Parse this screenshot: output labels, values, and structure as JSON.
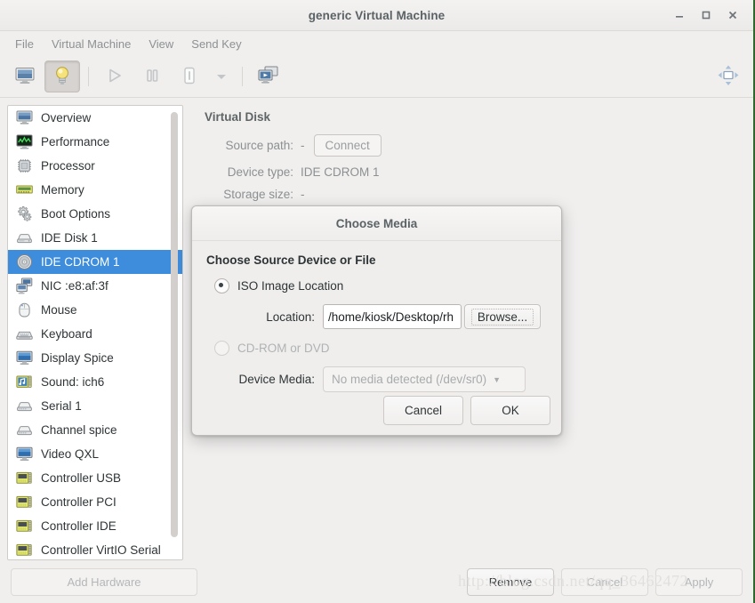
{
  "window": {
    "title": "generic Virtual Machine",
    "controls": [
      {
        "name": "minimize",
        "glyph": "–"
      },
      {
        "name": "maximize",
        "glyph": "□"
      },
      {
        "name": "close",
        "glyph": "✕"
      }
    ]
  },
  "menubar": {
    "items": [
      "File",
      "Virtual Machine",
      "View",
      "Send Key"
    ]
  },
  "toolbar": {
    "buttons": [
      {
        "name": "show-console-view",
        "icon": "monitor-icon",
        "pressed": false
      },
      {
        "name": "show-details-view",
        "icon": "lightbulb-icon",
        "pressed": true
      },
      {
        "name": "run-vm",
        "icon": "play-icon",
        "pressed": false
      },
      {
        "name": "pause-vm",
        "icon": "pause-icon",
        "pressed": false
      },
      {
        "name": "shutdown-vm",
        "icon": "power-icon",
        "pressed": false
      },
      {
        "name": "shutdown-menu",
        "icon": "chevron-down-icon",
        "pressed": false
      },
      {
        "name": "manage-snapshots",
        "icon": "snapshots-icon",
        "pressed": false
      }
    ],
    "fullscreen": {
      "name": "fullscreen-button",
      "icon": "expand-icon"
    }
  },
  "sidebar": {
    "items": [
      {
        "label": "Overview",
        "icon": "monitor-icon",
        "selected": false
      },
      {
        "label": "Performance",
        "icon": "graph-icon",
        "selected": false
      },
      {
        "label": "Processor",
        "icon": "cpu-icon",
        "selected": false
      },
      {
        "label": "Memory",
        "icon": "memory-icon",
        "selected": false
      },
      {
        "label": "Boot Options",
        "icon": "gears-icon",
        "selected": false
      },
      {
        "label": "IDE Disk 1",
        "icon": "harddisk-icon",
        "selected": false
      },
      {
        "label": "IDE CDROM 1",
        "icon": "cdrom-icon",
        "selected": true
      },
      {
        "label": "NIC :e8:af:3f",
        "icon": "network-icon",
        "selected": false
      },
      {
        "label": "Mouse",
        "icon": "mouse-icon",
        "selected": false
      },
      {
        "label": "Keyboard",
        "icon": "keyboard-icon",
        "selected": false
      },
      {
        "label": "Display Spice",
        "icon": "display-icon",
        "selected": false
      },
      {
        "label": "Sound: ich6",
        "icon": "sound-icon",
        "selected": false
      },
      {
        "label": "Serial 1",
        "icon": "serial-icon",
        "selected": false
      },
      {
        "label": "Channel spice",
        "icon": "serial-icon",
        "selected": false
      },
      {
        "label": "Video QXL",
        "icon": "display-icon",
        "selected": false
      },
      {
        "label": "Controller USB",
        "icon": "controller-icon",
        "selected": false
      },
      {
        "label": "Controller PCI",
        "icon": "controller-icon",
        "selected": false
      },
      {
        "label": "Controller IDE",
        "icon": "controller-icon",
        "selected": false
      },
      {
        "label": "Controller VirtIO Serial",
        "icon": "controller-icon",
        "selected": false
      }
    ]
  },
  "detail": {
    "heading": "Virtual Disk",
    "rows": [
      {
        "label": "Source path:",
        "value": "-",
        "button": "Connect"
      },
      {
        "label": "Device type:",
        "value": "IDE CDROM 1",
        "button": null
      },
      {
        "label": "Storage size:",
        "value": "-",
        "button": null
      }
    ]
  },
  "bottombar": {
    "add_hardware": "Add Hardware",
    "remove": "Remove",
    "cancel": "Cancel",
    "apply": "Apply"
  },
  "watermark": "http://blog.csdn.net/qq_36462472",
  "dialog": {
    "title": "Choose Media",
    "heading": "Choose Source Device or File",
    "iso_radio_label": "ISO Image Location",
    "location_label": "Location:",
    "location_value": "/home/kiosk/Desktop/rh",
    "location_placeholder": "",
    "browse_label": "Browse...",
    "cdrom_radio_label": "CD-ROM or DVD",
    "device_media_label": "Device Media:",
    "device_media_value": "No media detected (/dev/sr0)",
    "cancel_label": "Cancel",
    "ok_label": "OK"
  },
  "colors": {
    "selection_blue": "#3e8ddd",
    "window_bg": "#f0efee",
    "list_bg": "#ffffff",
    "text": "#2e3436",
    "muted_text": "#8c9092"
  }
}
